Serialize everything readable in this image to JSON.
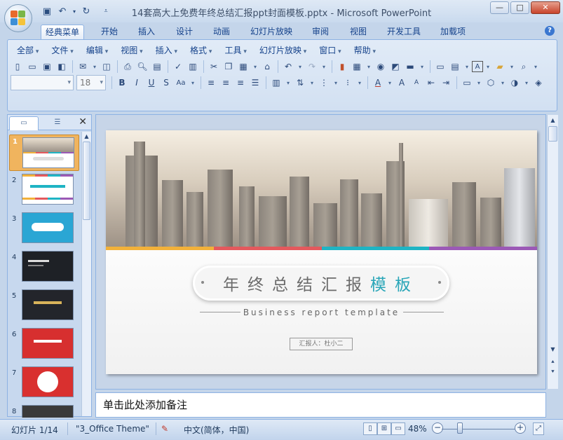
{
  "window": {
    "title": "14套高大上免费年终总结汇报ppt封面模板.pptx - Microsoft PowerPoint",
    "minimize": "—",
    "maximize": "□",
    "close": "✕"
  },
  "ribbon_tabs": [
    {
      "label": "经典菜单",
      "active": true
    },
    {
      "label": "开始"
    },
    {
      "label": "插入"
    },
    {
      "label": "设计"
    },
    {
      "label": "动画"
    },
    {
      "label": "幻灯片放映"
    },
    {
      "label": "审阅"
    },
    {
      "label": "视图"
    },
    {
      "label": "开发工具"
    },
    {
      "label": "加载项"
    }
  ],
  "classic_menu": [
    "全部",
    "文件",
    "编辑",
    "视图",
    "插入",
    "格式",
    "工具",
    "幻灯片放映",
    "窗口",
    "帮助"
  ],
  "font": {
    "name": "",
    "size": "18"
  },
  "thumbnail_panel": {
    "slides": [
      "1",
      "2",
      "3",
      "4",
      "5",
      "6",
      "7",
      "8"
    ],
    "selected": "1"
  },
  "slide": {
    "title_main": "年终总结汇报",
    "title_highlight": "模板",
    "subtitle": "Business report template",
    "reporter": "汇报人：杜小二",
    "accent_colors": [
      "#f2b13a",
      "#e4595d",
      "#1fb4c4",
      "#9b59b6"
    ]
  },
  "notes": {
    "placeholder": "单击此处添加备注"
  },
  "status": {
    "slide_counter": "幻灯片 1/14",
    "theme": "\"3_Office Theme\"",
    "language": "中文(简体，中国)",
    "zoom": "48%"
  },
  "icons": [
    "office-button-icon",
    "save-icon",
    "undo-icon",
    "redo-icon",
    "help-icon",
    "close-icon"
  ]
}
